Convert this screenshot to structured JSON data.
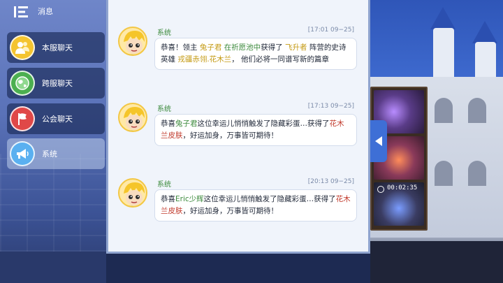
{
  "header": {
    "title": "消息"
  },
  "tabs": [
    {
      "label": "本服聊天",
      "icon": "people-icon",
      "color": "#f4c430"
    },
    {
      "label": "跨服聊天",
      "icon": "globe-icon",
      "color": "#4caf50"
    },
    {
      "label": "公会聊天",
      "icon": "flag-icon",
      "color": "#e04848"
    },
    {
      "label": "系统",
      "icon": "megaphone-icon",
      "color": "#5ab0f0",
      "active": true
    }
  ],
  "messages": [
    {
      "sender": "系统",
      "time": "[17:01 09−25]",
      "parts": [
        {
          "t": "恭喜！领主 ",
          "c": ""
        },
        {
          "t": "兔子君",
          "c": "y"
        },
        {
          "t": " ",
          "c": ""
        },
        {
          "t": "在祈愿池中",
          "c": "g"
        },
        {
          "t": "获得了 ",
          "c": ""
        },
        {
          "t": "飞升者",
          "c": "y"
        },
        {
          "t": " 阵营的史诗英雄 ",
          "c": ""
        },
        {
          "t": "戎疆赤翎.花木兰",
          "c": "y"
        },
        {
          "t": "， 他们必将一同谱写新的篇章",
          "c": ""
        }
      ]
    },
    {
      "sender": "系统",
      "time": "[17:13 09−25]",
      "parts": [
        {
          "t": "恭喜",
          "c": ""
        },
        {
          "t": "兔子君",
          "c": "g"
        },
        {
          "t": "这位幸运儿悄悄触发了隐藏彩蛋…获得了",
          "c": ""
        },
        {
          "t": "花木兰皮肤",
          "c": "r"
        },
        {
          "t": "，好运加身，万事皆可期待！",
          "c": ""
        }
      ]
    },
    {
      "sender": "系统",
      "time": "[20:13 09−25]",
      "parts": [
        {
          "t": "恭喜",
          "c": ""
        },
        {
          "t": "Eric少辉",
          "c": "g"
        },
        {
          "t": "这位幸运儿悄悄触发了隐藏彩蛋…获得了",
          "c": ""
        },
        {
          "t": "花木兰皮肤",
          "c": "r"
        },
        {
          "t": "，好运加身，万事皆可期待！",
          "c": ""
        }
      ]
    }
  ],
  "video": {
    "duration": "00:02:35"
  },
  "colors": {
    "highlight_yellow": "#c49a12",
    "highlight_green": "#3c8a3c",
    "highlight_red": "#c0392b"
  }
}
